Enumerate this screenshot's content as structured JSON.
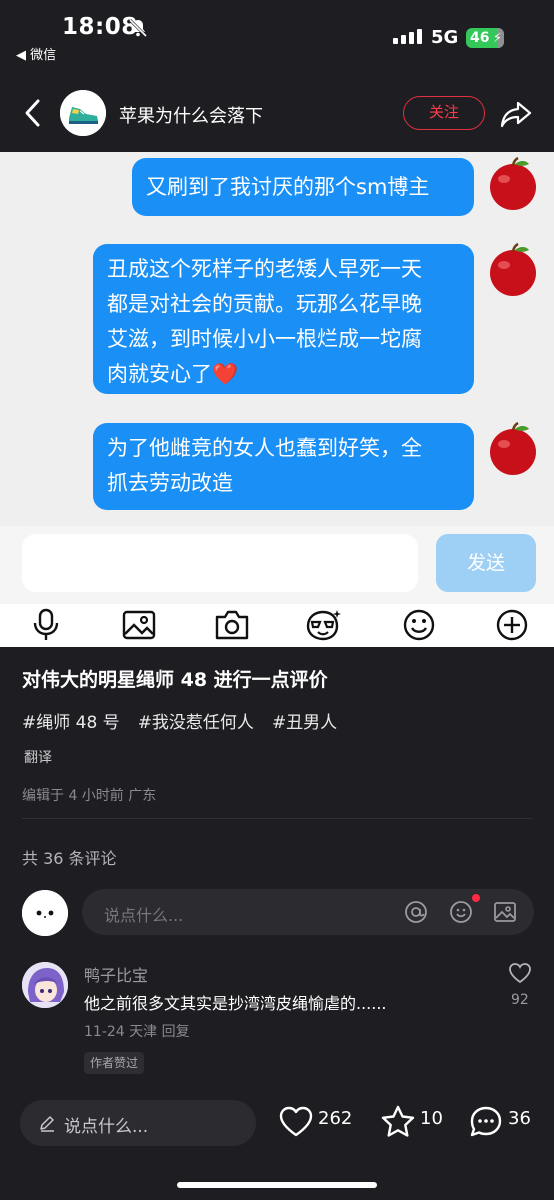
{
  "status_bar": {
    "time": "18:08",
    "back_app": "◀ 微信",
    "network": "5G",
    "battery": "46"
  },
  "header": {
    "title": "苹果为什么会落下",
    "follow_label": "关注"
  },
  "chat": {
    "messages": [
      {
        "text": "又刷到了我讨厌的那个sm博主"
      },
      {
        "line1": "丑成这个死样子的老矮人早死一天",
        "line2": "都是对社会的贡献。玩那么花早晚",
        "line3": "艾滋，到时候小小一根烂成一坨腐",
        "line4": "肉就安心了❤️"
      },
      {
        "line1": "为了他雌竞的女人也蠢到好笑，全",
        "line2": "抓去劳动改造"
      }
    ],
    "send_label": "发送",
    "toolbar_icons": [
      "microphone-icon",
      "image-icon",
      "camera-icon",
      "sticker-icon",
      "emoji-icon",
      "plus-icon"
    ]
  },
  "post": {
    "title": "对伟大的明星绳师 48 进行一点评价",
    "tags": [
      "#绳师 48 号",
      "#我没惹任何人",
      "#丑男人"
    ],
    "translate_label": "翻译",
    "edit_info": "编辑于 4 小时前 广东"
  },
  "comments": {
    "count_label": "共 36 条评论",
    "input_placeholder": "说点什么...",
    "items": [
      {
        "user": "鸭子比宝",
        "text": "他之前很多文其实是抄湾湾皮绳愉虐的......",
        "meta": "11-24 天津 回复",
        "badge": "作者赞过",
        "likes": "92"
      }
    ]
  },
  "bottom_bar": {
    "input_placeholder": "说点什么...",
    "likes": "262",
    "favorites": "10",
    "comments": "36"
  },
  "colors": {
    "bubble": "#1a8ff5",
    "follow": "#ff3b4a",
    "background": "#1e1e22",
    "battery": "#34c759"
  }
}
